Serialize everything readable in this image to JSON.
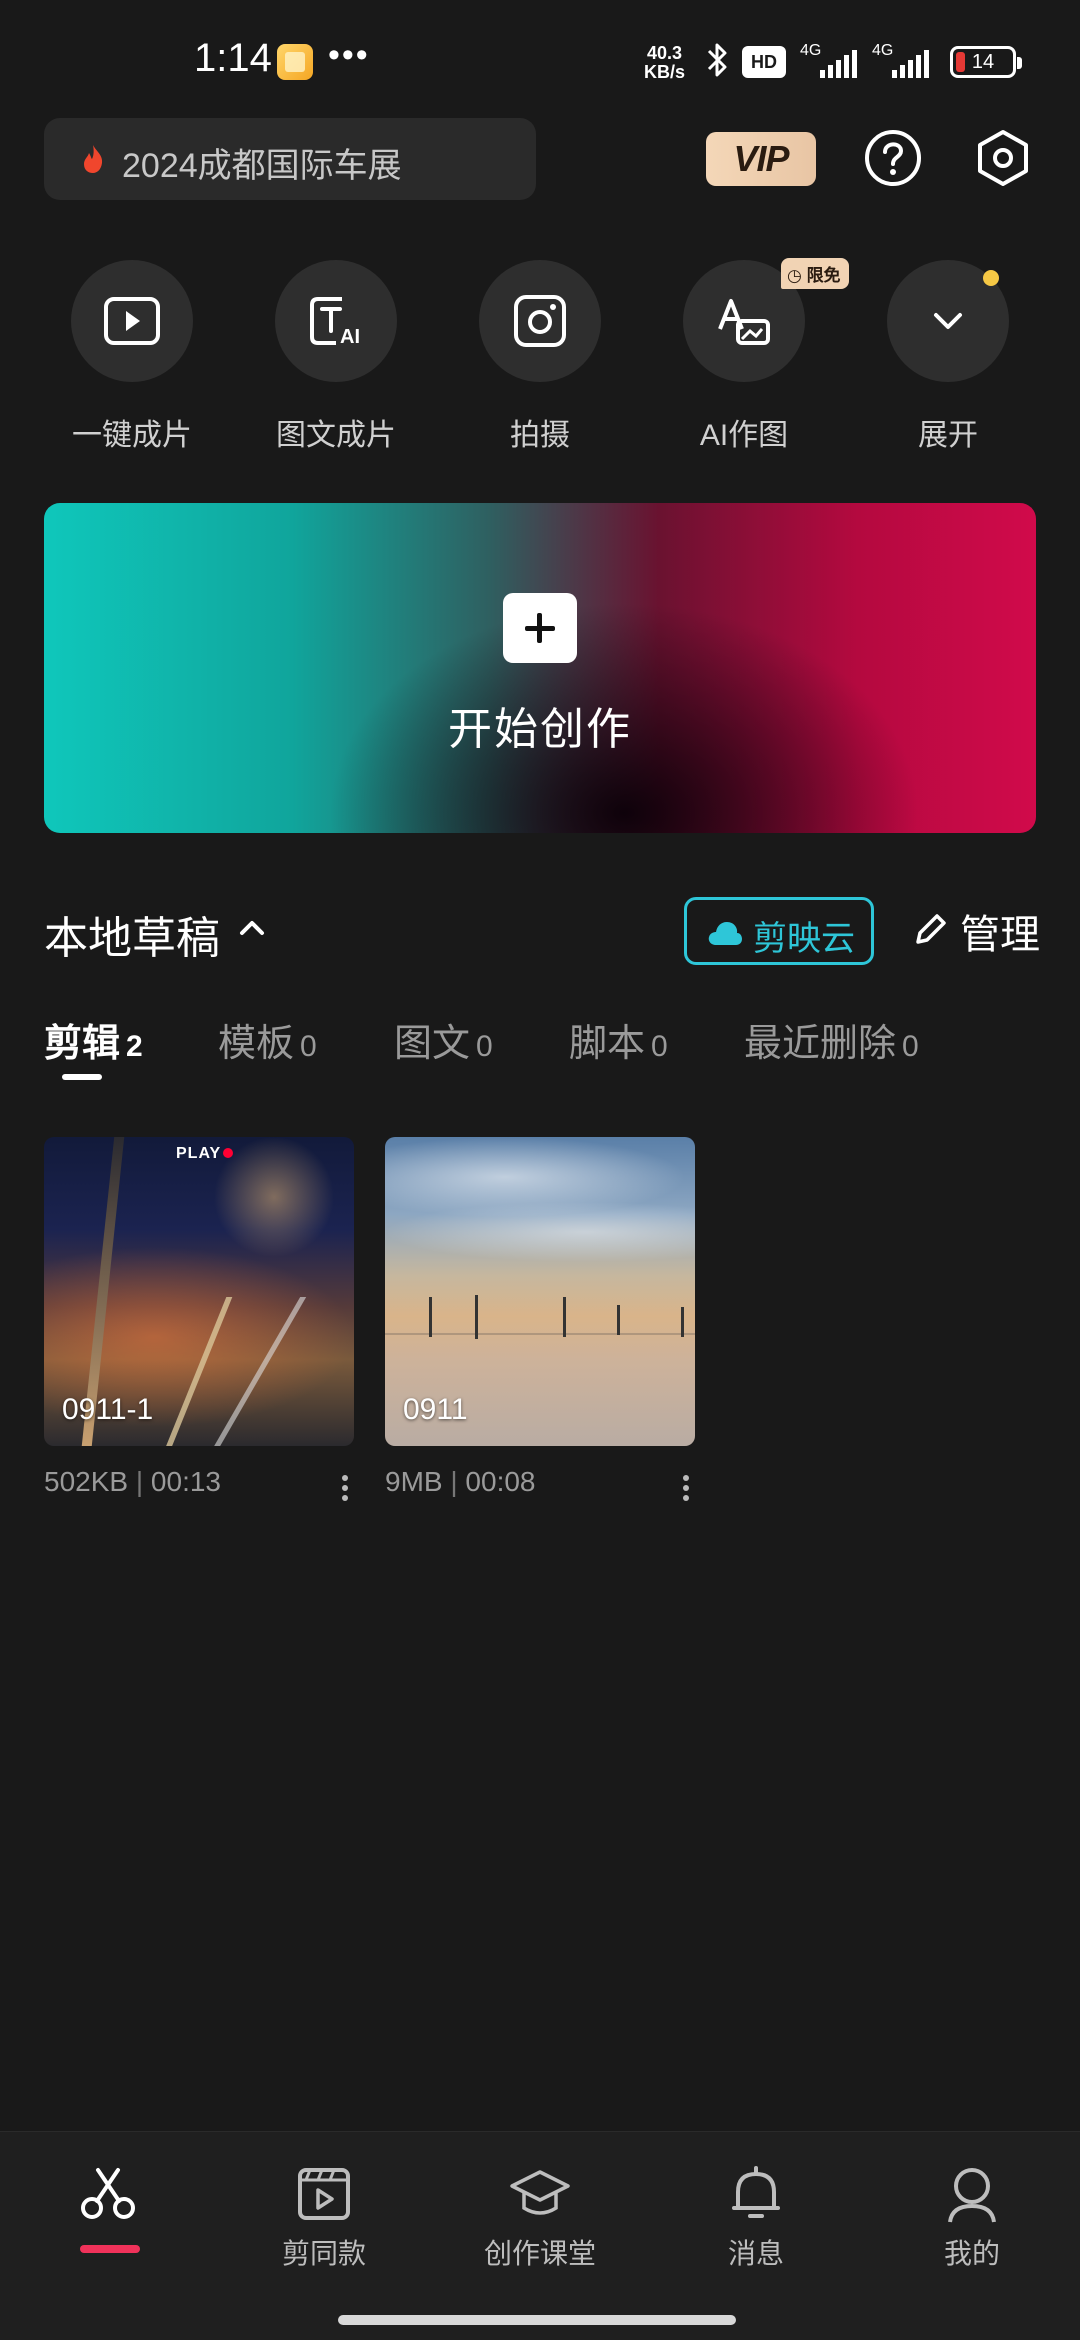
{
  "status_bar": {
    "time": "1:14",
    "net_speed_value": "40.3",
    "net_speed_unit": "KB/s",
    "hd_label": "HD",
    "sim1_label": "4G",
    "sim2_label": "4G",
    "battery": "14",
    "icons": [
      "app-notification-icon",
      "more-dots-icon",
      "bluetooth-icon",
      "hd-voice-icon",
      "signal-icon",
      "battery-icon"
    ]
  },
  "header": {
    "search_text": "2024成都国际车展",
    "vip_label": "VIP",
    "icons": [
      "flame-icon",
      "help-icon",
      "settings-icon"
    ]
  },
  "tools": [
    {
      "label": "一键成片",
      "icon": "play-icon"
    },
    {
      "label": "图文成片",
      "icon": "text-ai-icon"
    },
    {
      "label": "拍摄",
      "icon": "camera-icon"
    },
    {
      "label": "AI作图",
      "icon": "ai-draw-icon",
      "badge": "限免"
    },
    {
      "label": "展开",
      "icon": "chevron-down-icon"
    }
  ],
  "banner": {
    "title": "开始创作"
  },
  "drafts_section": {
    "title": "本地草稿",
    "cloud_label": "剪映云",
    "manage_label": "管理"
  },
  "tabs": [
    {
      "name": "剪辑",
      "count": "2",
      "active": true
    },
    {
      "name": "模板",
      "count": "0"
    },
    {
      "name": "图文",
      "count": "0"
    },
    {
      "name": "脚本",
      "count": "0"
    },
    {
      "name": "最近删除",
      "count": "0"
    }
  ],
  "drafts": [
    {
      "name": "0911-1",
      "size": "502KB",
      "duration": "00:13",
      "overlay_text": "PLAY"
    },
    {
      "name": "0911",
      "size": "9MB",
      "duration": "00:08"
    }
  ],
  "bottom_nav": [
    {
      "label": "",
      "icon": "scissors-icon",
      "active": true
    },
    {
      "label": "剪同款",
      "icon": "template-icon"
    },
    {
      "label": "创作课堂",
      "icon": "graduation-cap-icon"
    },
    {
      "label": "消息",
      "icon": "bell-icon"
    },
    {
      "label": "我的",
      "icon": "profile-icon"
    }
  ],
  "colors": {
    "background": "#191919",
    "accent_cyan": "#2ec6d8",
    "accent_red": "#f0325a",
    "vip_gold": "#f1d3b4",
    "notify_dot": "#f6c845"
  }
}
